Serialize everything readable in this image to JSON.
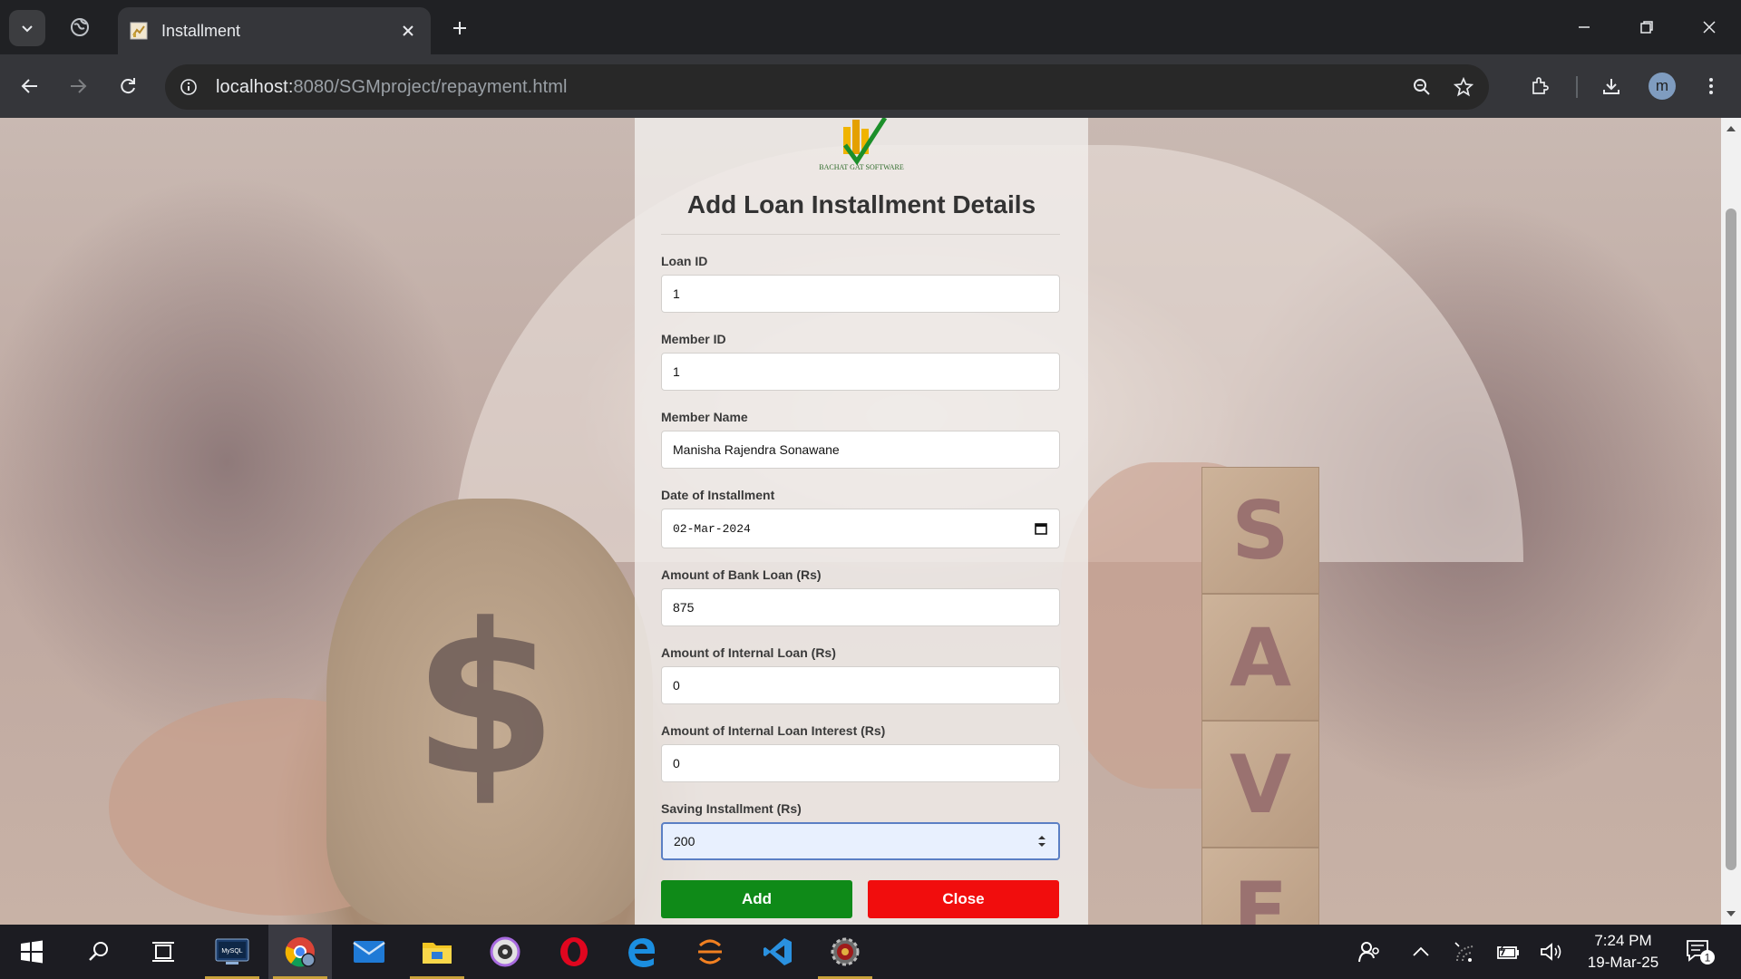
{
  "browser": {
    "tab": {
      "title": "Installment"
    },
    "url": {
      "host": "localhost:",
      "path": "8080/SGMproject/repayment.html"
    }
  },
  "page": {
    "logo_text": "BACHAT GAT SOFTWARE",
    "title": "Add Loan Installment Details",
    "fields": [
      {
        "label": "Loan ID",
        "value": "1"
      },
      {
        "label": "Member ID",
        "value": "1"
      },
      {
        "label": "Member Name",
        "value": "Manisha Rajendra Sonawane"
      },
      {
        "label": "Date of Installment",
        "value": "02-Mar-2024"
      },
      {
        "label": "Amount of Bank Loan (Rs)",
        "value": "875"
      },
      {
        "label": "Amount of Internal Loan (Rs)",
        "value": "0"
      },
      {
        "label": "Amount of Internal Loan Interest (Rs)",
        "value": "0"
      },
      {
        "label": "Saving Installment (Rs)",
        "value": "200"
      }
    ],
    "add_label": "Add",
    "close_label": "Close",
    "background_letters": [
      "S",
      "A",
      "V",
      "E"
    ],
    "background_symbol": "$"
  },
  "taskbar": {
    "clock_time": "7:24 PM",
    "clock_date": "19-Mar-25",
    "notification_count": "1",
    "mysql_label": "MySQL"
  },
  "colors": {
    "add_button": "#0f8a18",
    "close_button": "#f10d0d",
    "focus_border": "#5b7fc4"
  }
}
